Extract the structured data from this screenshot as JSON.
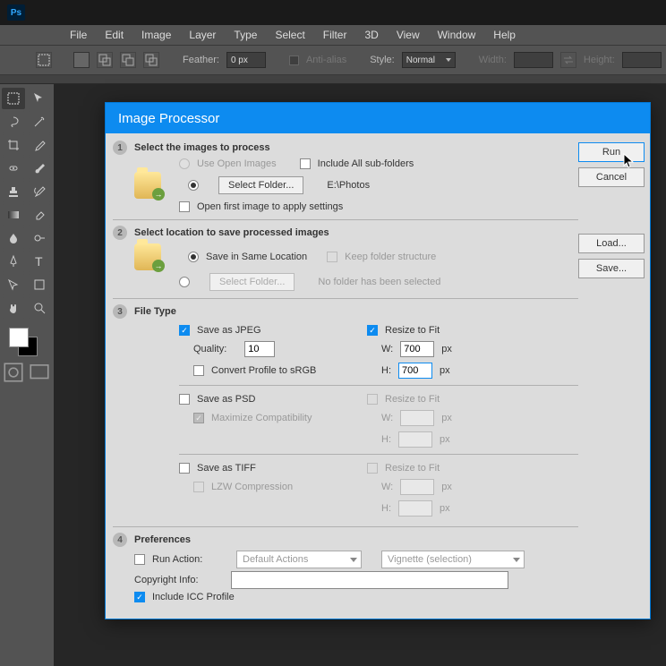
{
  "menu": {
    "file": "File",
    "edit": "Edit",
    "image": "Image",
    "layer": "Layer",
    "type": "Type",
    "select": "Select",
    "filter": "Filter",
    "threeD": "3D",
    "view": "View",
    "window": "Window",
    "help": "Help"
  },
  "options": {
    "feather_label": "Feather:",
    "feather_value": "0 px",
    "antialias": "Anti-alias",
    "style_label": "Style:",
    "style_value": "Normal",
    "width_label": "Width:",
    "height_label": "Height:"
  },
  "dialog": {
    "title": "Image Processor",
    "buttons": {
      "run": "Run",
      "cancel": "Cancel",
      "load": "Load...",
      "save": "Save..."
    },
    "s1": {
      "title": "Select the images to process",
      "use_open": "Use Open Images",
      "include_sub": "Include All sub-folders",
      "select_folder": "Select Folder...",
      "path": "E:\\Photos",
      "open_first": "Open first image to apply settings"
    },
    "s2": {
      "title": "Select location to save processed images",
      "same_loc": "Save in Same Location",
      "keep_struct": "Keep folder structure",
      "select_folder": "Select Folder...",
      "no_folder": "No folder has been selected"
    },
    "s3": {
      "title": "File Type",
      "jpeg": {
        "label": "Save as JPEG",
        "quality_label": "Quality:",
        "quality_value": "10",
        "convert_srgb": "Convert Profile to sRGB",
        "resize": "Resize to Fit",
        "w_label": "W:",
        "w_value": "700",
        "h_label": "H:",
        "h_value": "700",
        "px": "px"
      },
      "psd": {
        "label": "Save as PSD",
        "max_compat": "Maximize Compatibility",
        "resize": "Resize to Fit",
        "w_label": "W:",
        "h_label": "H:",
        "px": "px"
      },
      "tiff": {
        "label": "Save as TIFF",
        "lzw": "LZW Compression",
        "resize": "Resize to Fit",
        "w_label": "W:",
        "h_label": "H:",
        "px": "px"
      }
    },
    "s4": {
      "title": "Preferences",
      "run_action": "Run Action:",
      "action_set": "Default Actions",
      "action": "Vignette (selection)",
      "copyright": "Copyright Info:",
      "icc": "Include ICC Profile"
    }
  }
}
